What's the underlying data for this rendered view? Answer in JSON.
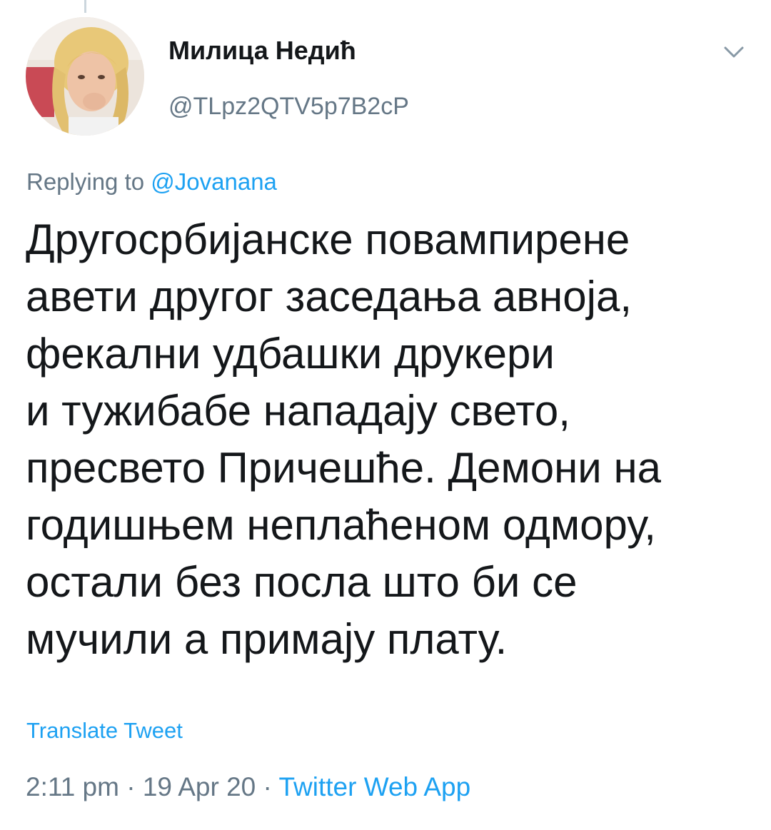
{
  "tweet": {
    "author": {
      "display_name": "Милица Недић",
      "handle": "@TLpz2QTV5p7B2cP",
      "avatar_icon": "user-avatar-photo"
    },
    "menu_icon": "chevron-down-icon",
    "reply_context": {
      "prefix": "Replying to",
      "mention": "@Jovanana"
    },
    "text_lines": [
      "Другосрбијанске повампирене",
      "авети другог заседања авноја,",
      "фекални удбашки друкери",
      "и тужибабе нападају свето,",
      "пресвето Причешће. Демони на",
      "годишњем неплаћеном одмору,",
      "остали без посла што би се",
      "мучили а примају плату."
    ],
    "translate_label": "Translate Tweet",
    "time": "2:11 pm",
    "separator": "·",
    "date": "19 Apr 20",
    "source": "Twitter Web App"
  },
  "colors": {
    "link": "#1da1f2",
    "secondary_text": "#657786",
    "primary_text": "#14171a",
    "thread_line": "#ccd6dd"
  }
}
